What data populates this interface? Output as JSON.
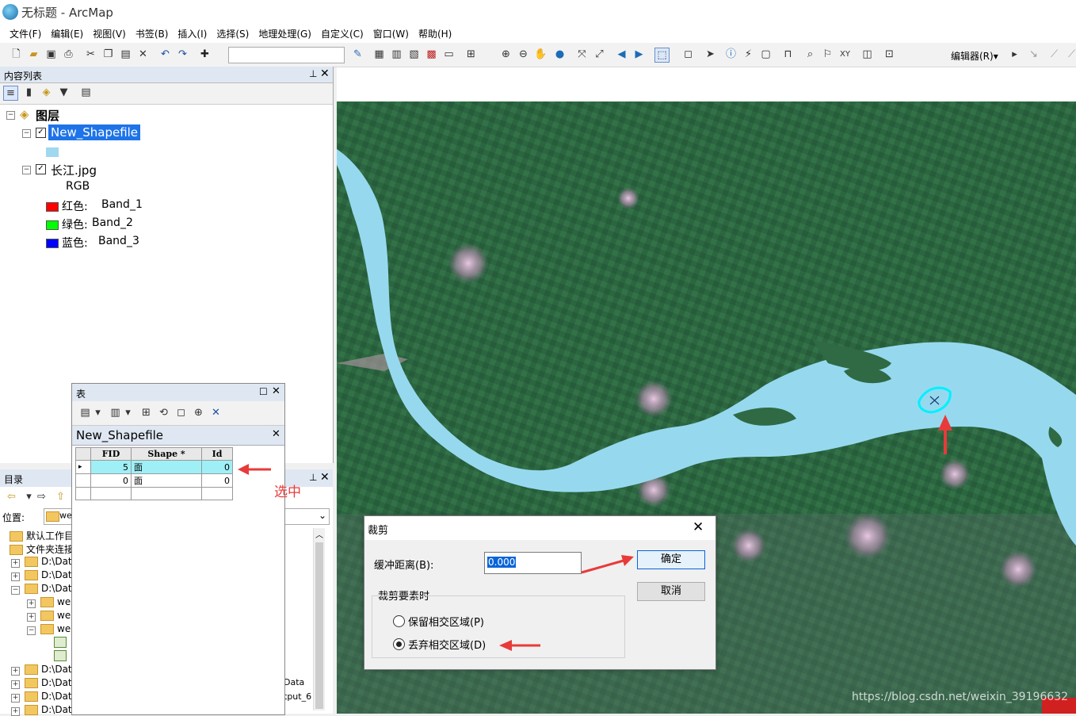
{
  "window": {
    "title": "无标题 - ArcMap"
  },
  "menu": [
    "文件(F)",
    "编辑(E)",
    "视图(V)",
    "书签(B)",
    "插入(I)",
    "选择(S)",
    "地理处理(G)",
    "自定义(C)",
    "窗口(W)",
    "帮助(H)"
  ],
  "toolbar": {
    "editor_label": "编辑器(R)▾"
  },
  "toc": {
    "title": "内容列表",
    "root": "图层",
    "layers": [
      {
        "name": "New_Shapefile",
        "swatch_color": "#9fd8ef"
      },
      {
        "name": "长江.jpg",
        "sub": "RGB"
      }
    ],
    "bands": [
      {
        "label": "红色:",
        "value": "Band_1",
        "color": "#ff0000"
      },
      {
        "label": "绿色:",
        "value": "Band_2",
        "color": "#00ff00"
      },
      {
        "label": "蓝色:",
        "value": "Band_3",
        "color": "#0000ff"
      }
    ]
  },
  "catalog": {
    "title": "目录",
    "location_label": "位置:",
    "location_value": "we",
    "items": [
      "默认工作目",
      "文件夹连接",
      "D:\\Dat",
      "D:\\Dat",
      "D:\\Dat",
      "wee",
      "wee",
      "wee",
      "D:\\Dat",
      "D:\\Dat",
      "D:\\Dat",
      "D:\\Dat"
    ],
    "right_fragments": [
      "Data",
      "tput_6"
    ]
  },
  "table_window": {
    "title": "表",
    "layer_tab": "New_Shapefile",
    "columns": [
      "FID",
      "Shape *",
      "Id"
    ],
    "rows": [
      {
        "fid": "5",
        "shape": "面",
        "id": "0",
        "selected": true
      },
      {
        "fid": "0",
        "shape": "面",
        "id": "0",
        "selected": false
      }
    ],
    "annotation": "选中"
  },
  "dialog": {
    "title": "裁剪",
    "buffer_label": "缓冲距离(B):",
    "buffer_value": "0.000",
    "ok": "确定",
    "cancel": "取消",
    "group_label": "裁剪要素时",
    "option_keep": "保留相交区域(P)",
    "option_discard": "丢弃相交区域(D)",
    "selected_option": "discard"
  },
  "watermark": "https://blog.csdn.net/weixin_39196632"
}
